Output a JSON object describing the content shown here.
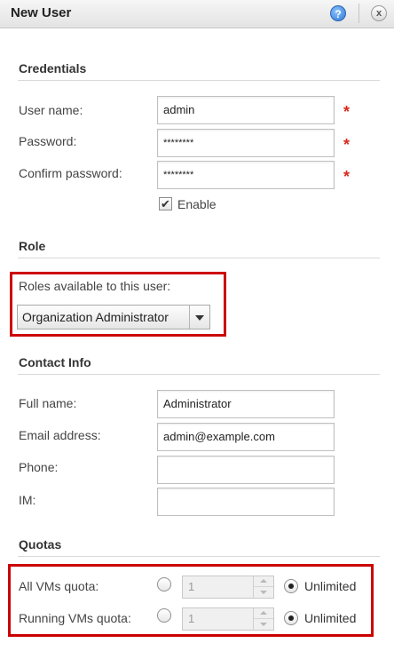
{
  "dialog": {
    "title": "New User",
    "help_icon": "help-icon",
    "help_glyph": "?",
    "close_icon": "close-icon",
    "close_glyph": "x"
  },
  "credentials": {
    "section_title": "Credentials",
    "username_label": "User name:",
    "username_value": "admin",
    "password_label": "Password:",
    "password_value": "********",
    "confirm_label": "Confirm password:",
    "confirm_value": "********",
    "required_mark": "*",
    "enable_label": "Enable",
    "enable_checked": true,
    "check_glyph": "✔"
  },
  "role": {
    "section_title": "Role",
    "roles_label": "Roles available to this user:",
    "selected_role": "Organization Administrator"
  },
  "contact": {
    "section_title": "Contact Info",
    "fullname_label": "Full name:",
    "fullname_value": "Administrator",
    "email_label": "Email address:",
    "email_value": "admin@example.com",
    "phone_label": "Phone:",
    "phone_value": "",
    "im_label": "IM:",
    "im_value": ""
  },
  "quotas": {
    "section_title": "Quotas",
    "all_vms_label": "All VMs quota:",
    "all_vms_value": "1",
    "running_vms_label": "Running VMs quota:",
    "running_vms_value": "1",
    "unlimited_label": "Unlimited"
  },
  "colors": {
    "required": "#d52b1e",
    "highlight": "#cc0000",
    "help_blue": "#2f78d6"
  }
}
